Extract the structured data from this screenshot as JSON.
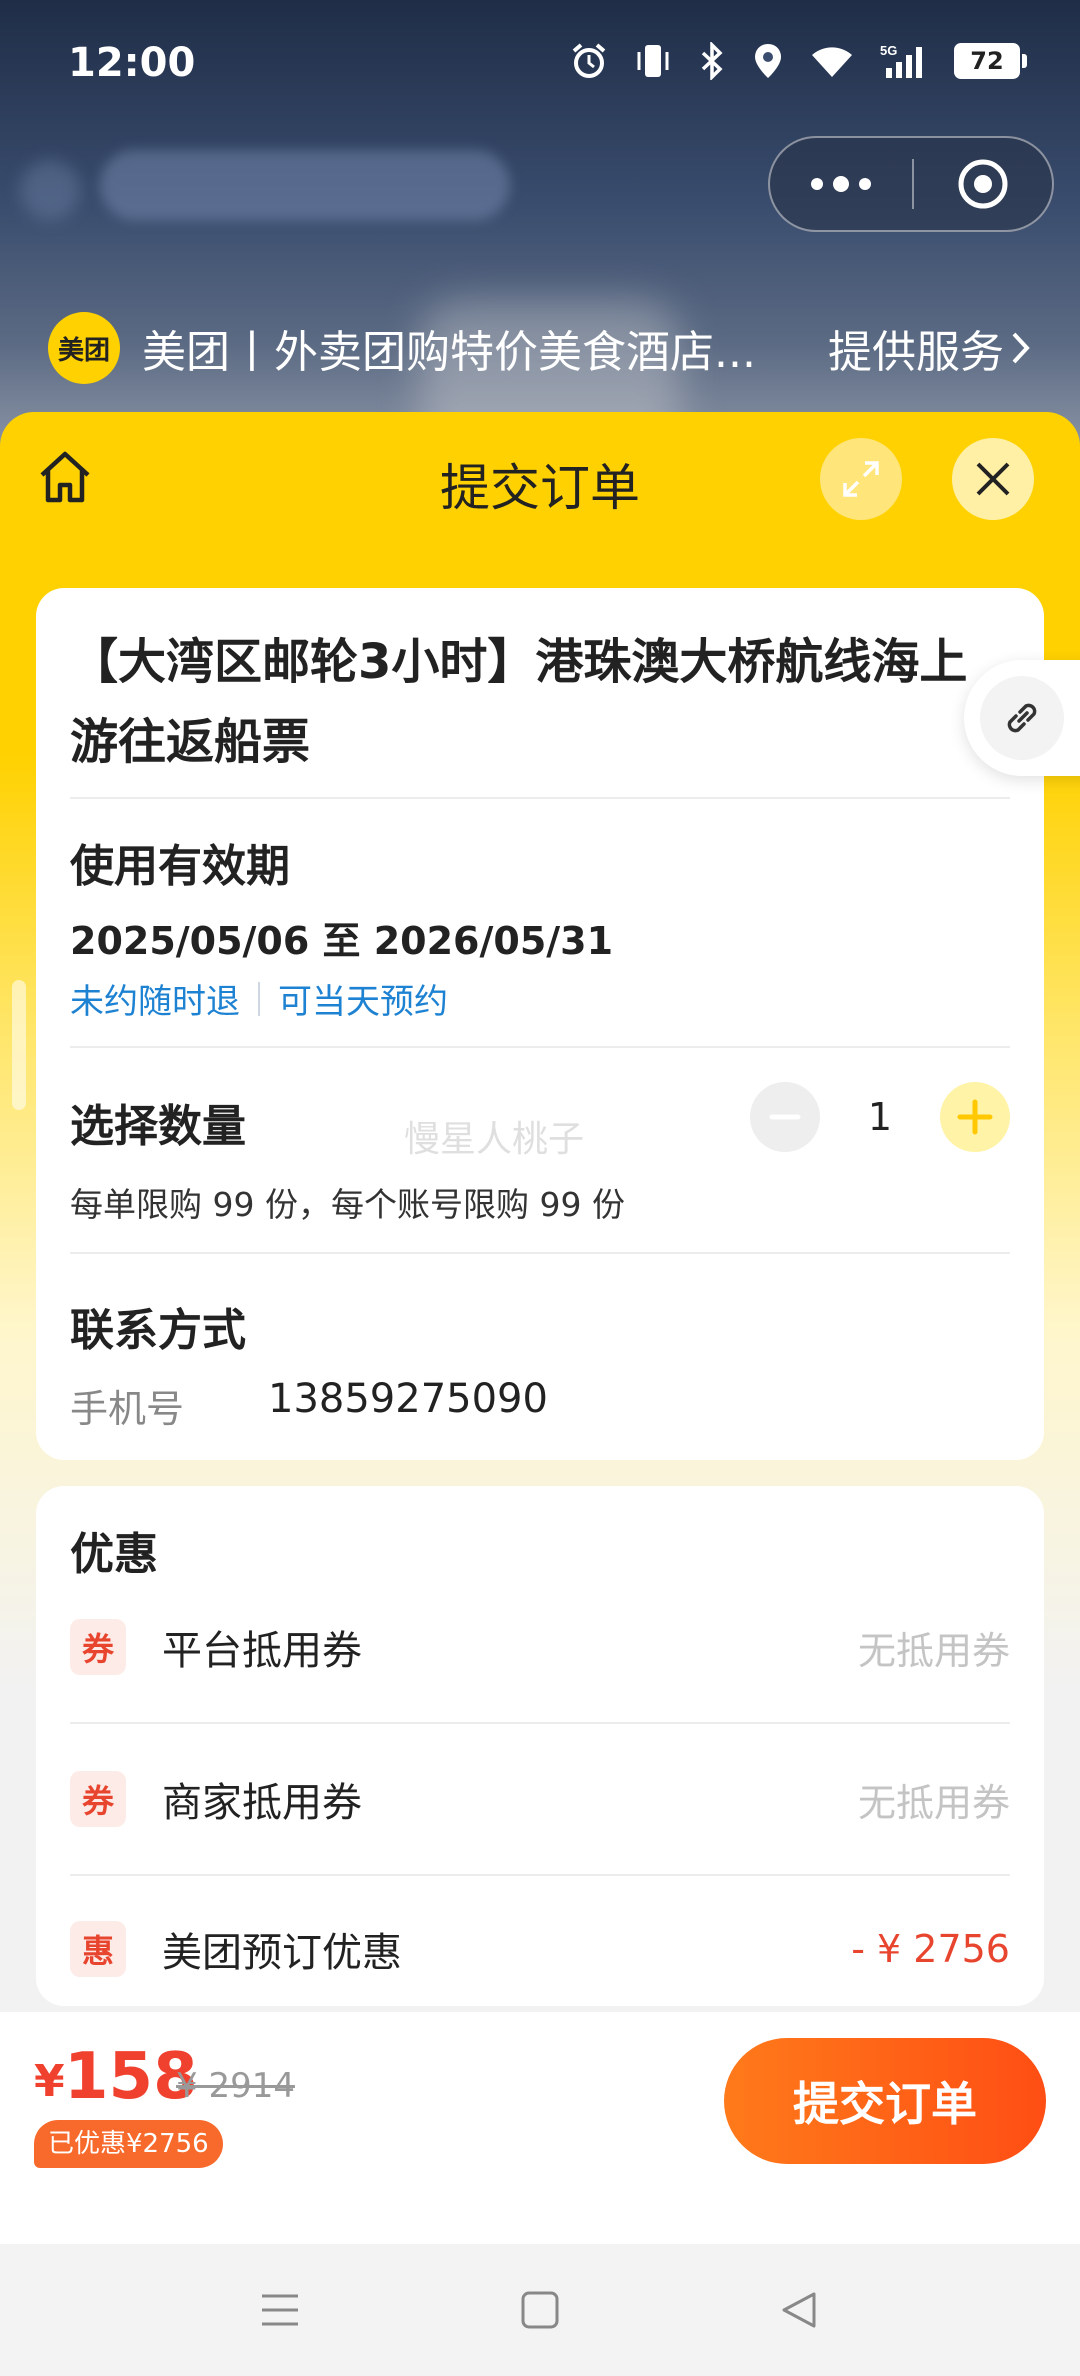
{
  "status_bar": {
    "time": "12:00",
    "battery": "72"
  },
  "mini_program": {
    "logo_text": "美团",
    "title": "美团丨外卖团购特价美食酒店...",
    "service_link": "提供服务"
  },
  "sheet": {
    "title": "提交订单"
  },
  "product": {
    "title": "【大湾区邮轮3小时】港珠澳大桥航线海上游往返船票"
  },
  "validity": {
    "heading": "使用有效期",
    "dates": "2025/05/06 至 2026/05/31",
    "tags": [
      "未约随时退",
      "可当天预约"
    ]
  },
  "quantity": {
    "heading": "选择数量",
    "value": "1",
    "limit_text": "每单限购 99 份，每个账号限购 99 份",
    "watermark": "慢星人桃子"
  },
  "contact": {
    "heading": "联系方式",
    "phone_label": "手机号",
    "phone_value": "13859275090"
  },
  "discounts": {
    "heading": "优惠",
    "items": [
      {
        "badge": "券",
        "label": "平台抵用券",
        "value": "无抵用券"
      },
      {
        "badge": "券",
        "label": "商家抵用券",
        "value": "无抵用券"
      },
      {
        "badge": "惠",
        "label": "美团预订优惠",
        "value": "- ¥ 2756"
      }
    ]
  },
  "footer": {
    "currency": "¥",
    "price": "158",
    "original_price": "¥ 2914",
    "saved_text": "已优惠¥2756",
    "submit_label": "提交订单"
  },
  "colors": {
    "brand_yellow": "#ffd100",
    "price_red": "#f0412f",
    "link_blue": "#1e82d2",
    "submit_orange": "#ff5a16"
  }
}
